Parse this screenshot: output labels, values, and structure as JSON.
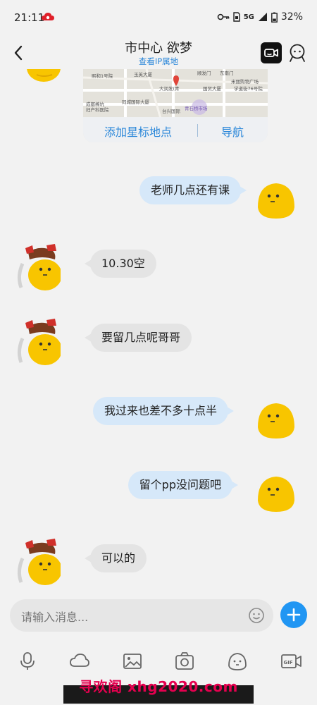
{
  "status_bar": {
    "time": "21:11",
    "network": "5G",
    "battery": "32%"
  },
  "header": {
    "back_icon": "chevron-left-icon",
    "title": "市中心  欲梦",
    "subtitle": "查看IP属地"
  },
  "map_card": {
    "star_label": "添加星标地点",
    "nav_label": "导航",
    "map_labels": [
      "东南门",
      "玉英大厦",
      "顺发门",
      "熙和1号院",
      "大润发(青",
      "国贸大厦",
      "米丽购物广场",
      "学道街76号院",
      "同城国际大厦",
      "台兴国际",
      "青石桥市场",
      "成都棒坑",
      "妇产科医院"
    ]
  },
  "messages": [
    {
      "from": "me",
      "text": "老师几点还有课"
    },
    {
      "from": "them",
      "text": "10.30空"
    },
    {
      "from": "them",
      "text": "要留几点呢哥哥"
    },
    {
      "from": "me",
      "text": "我过来也差不多十点半"
    },
    {
      "from": "me",
      "text": "留个pp没问题吧"
    },
    {
      "from": "them",
      "text": "可以的"
    }
  ],
  "input": {
    "placeholder": "请输入消息..."
  },
  "toolbar": [
    "mic-icon",
    "cloud-icon",
    "image-icon",
    "camera-icon",
    "emoji-icon",
    "gif-icon"
  ],
  "watermark": "寻欢阁 xhg2020.com",
  "colors": {
    "accent": "#2196f3",
    "link": "#2b87d9",
    "out_bubble": "#d6e8f9",
    "in_bubble": "#e4e4e4",
    "watermark": "#e5004f"
  }
}
